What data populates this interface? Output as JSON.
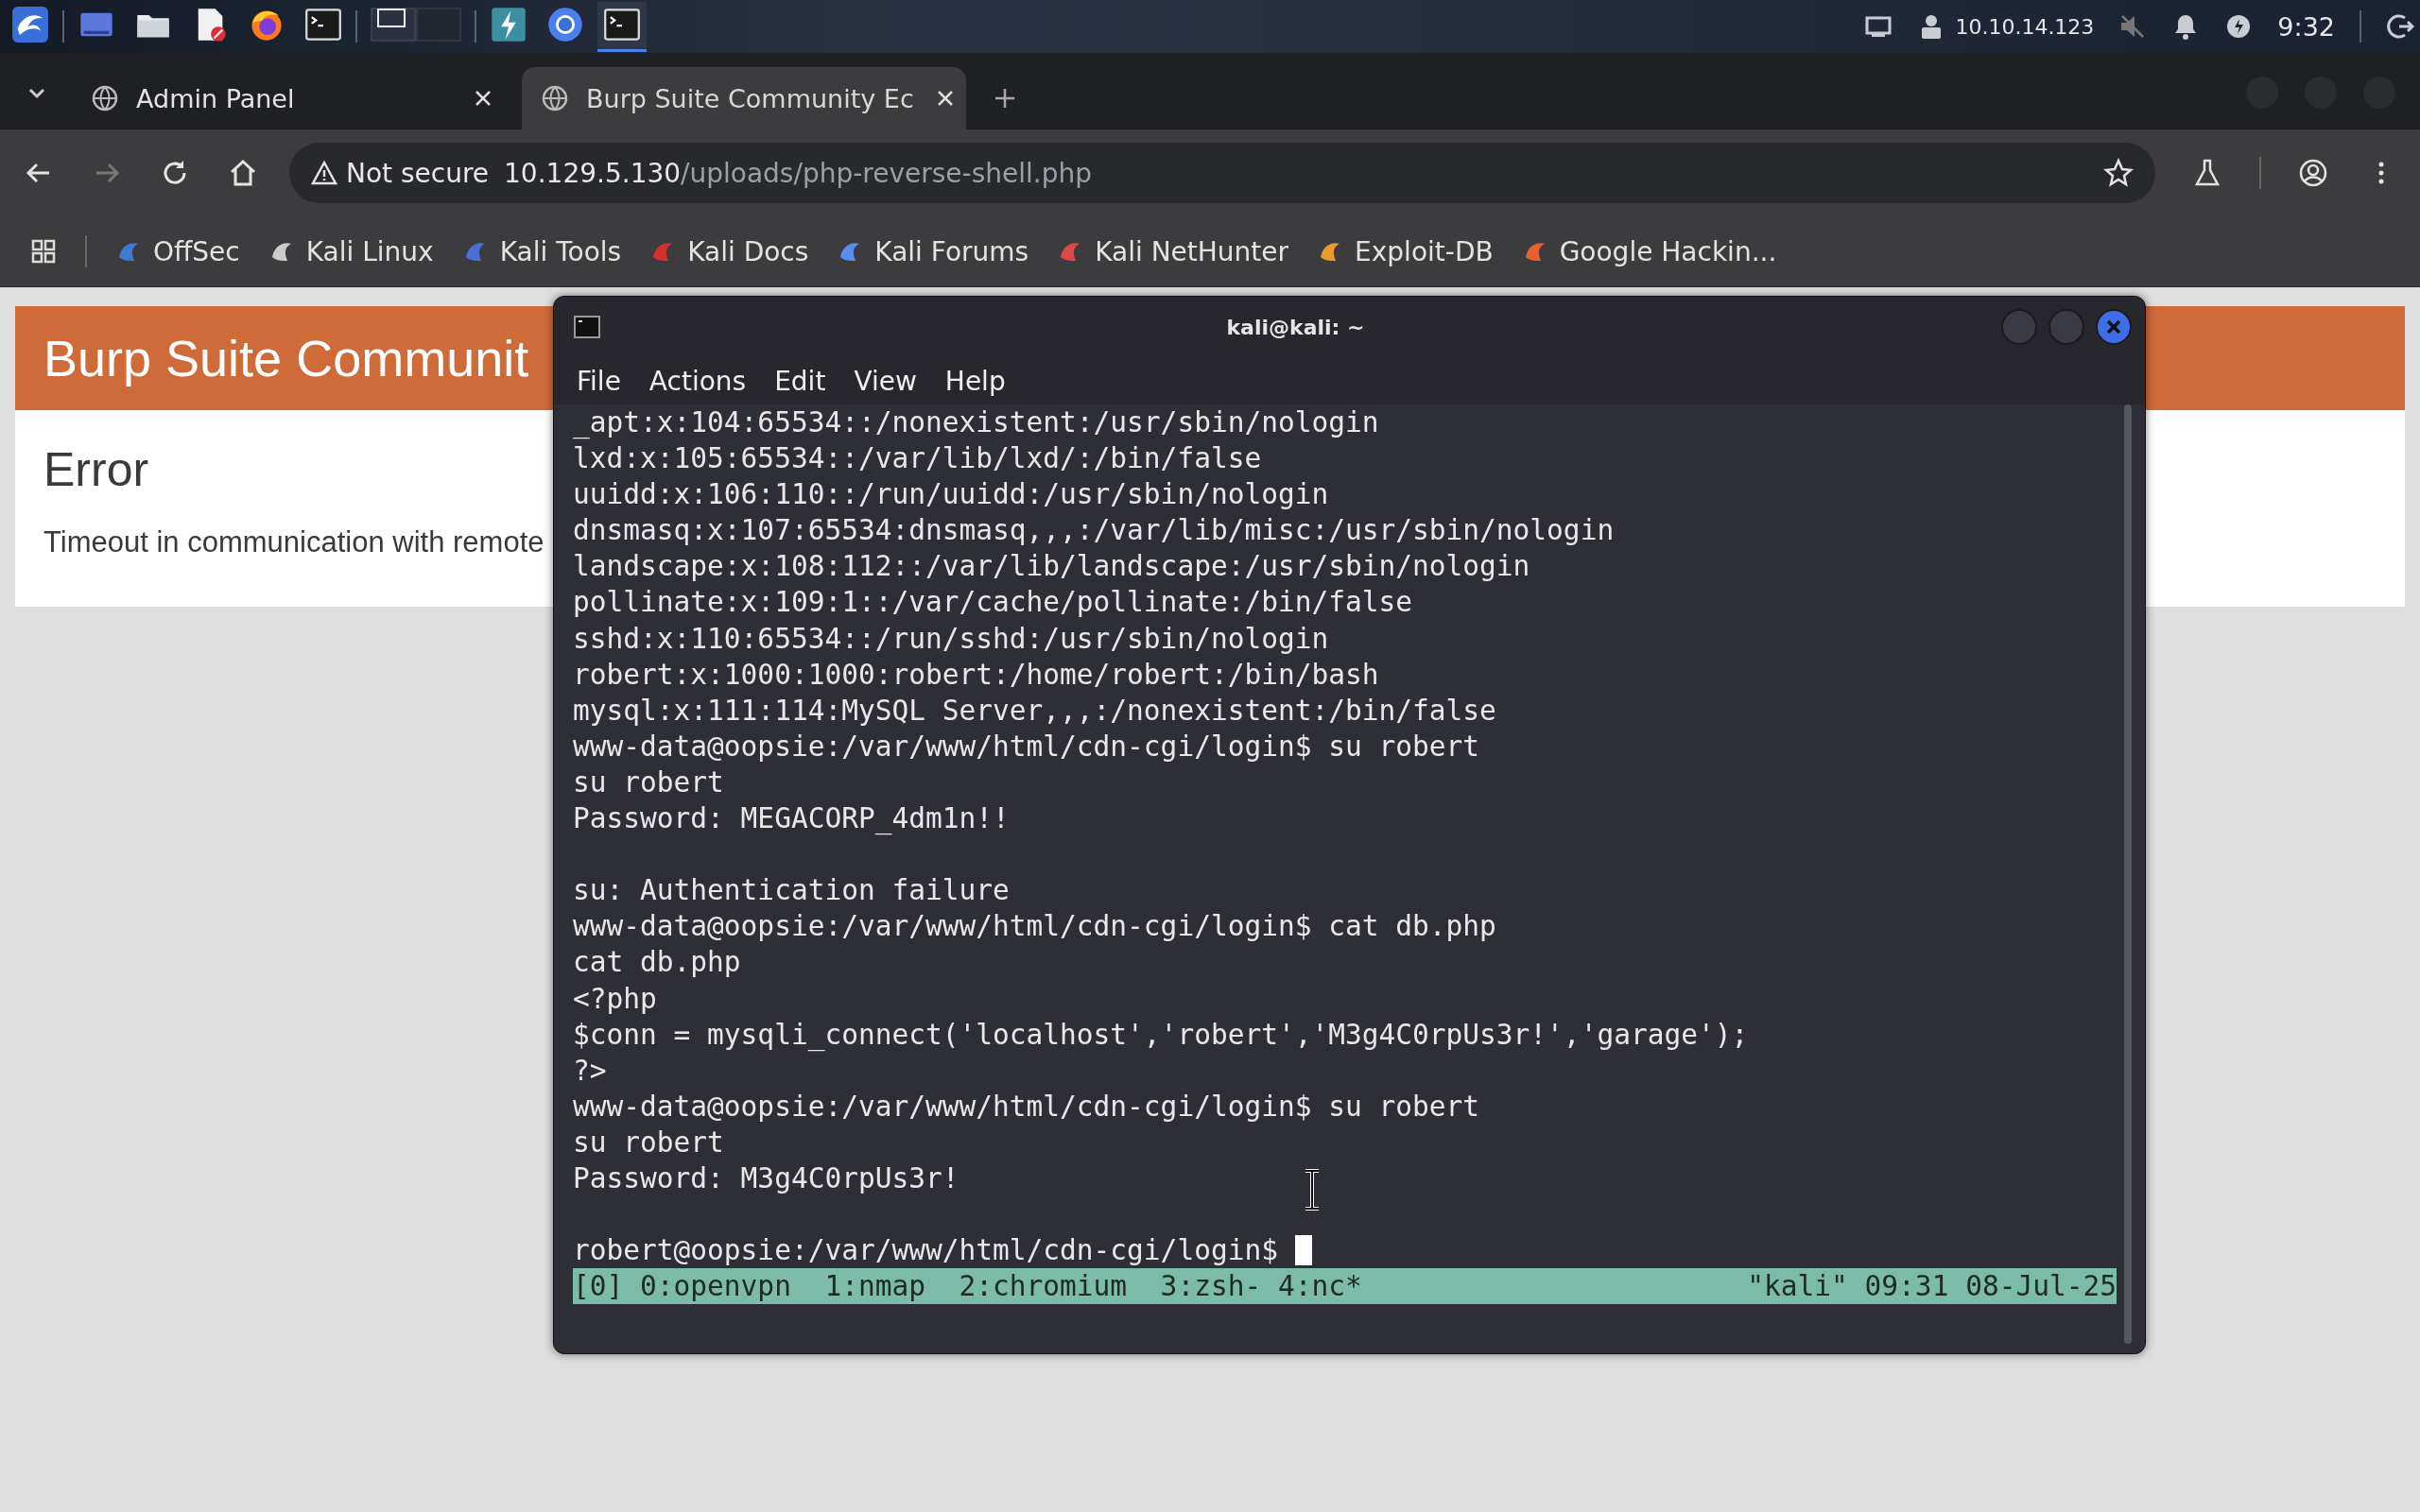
{
  "taskbar": {
    "apps": [
      {
        "kind": "menu",
        "selected": false
      },
      {
        "kind": "desktop",
        "selected": false
      },
      {
        "kind": "files",
        "selected": false
      },
      {
        "kind": "editor",
        "selected": false
      },
      {
        "kind": "firefox",
        "selected": false
      },
      {
        "kind": "terminal",
        "selected": false
      },
      {
        "kind": "workspaces",
        "selected": false
      },
      {
        "kind": "bolt",
        "selected": false
      },
      {
        "kind": "chromium",
        "selected": false
      },
      {
        "kind": "terminal",
        "selected": true
      }
    ],
    "ip": "10.10.14.123",
    "clock": "9:32"
  },
  "browser": {
    "tabs": [
      {
        "title": "Admin Panel",
        "selected": false
      },
      {
        "title": "Burp Suite Community Ec",
        "selected": true
      }
    ],
    "security": "Not secure",
    "url_host": "10.129.5.130",
    "url_path": "/uploads/php-reverse-shell.php",
    "bookmarks": [
      {
        "label": "OffSec",
        "color": "#3d7bd6"
      },
      {
        "label": "Kali Linux",
        "color": "#cccccc"
      },
      {
        "label": "Kali Tools",
        "color": "#4a6fd8"
      },
      {
        "label": "Kali Docs",
        "color": "#d32f2f"
      },
      {
        "label": "Kali Forums",
        "color": "#5b8def"
      },
      {
        "label": "Kali NetHunter",
        "color": "#e04848"
      },
      {
        "label": "Exploit-DB",
        "color": "#e89a2c"
      },
      {
        "label": "Google Hackin...",
        "color": "#e8602c"
      }
    ]
  },
  "page": {
    "title": "Burp Suite Communit",
    "heading": "Error",
    "message": "Timeout in communication with remote"
  },
  "terminal": {
    "title": "kali@kali: ~",
    "menu": [
      "File",
      "Actions",
      "Edit",
      "View",
      "Help"
    ],
    "lines": [
      {
        "text": "_apt:x:104:65534::/nonexistent:/usr/sbin/nologin",
        "blank_after": false,
        "cursor": false
      },
      {
        "text": "lxd:x:105:65534::/var/lib/lxd/:/bin/false",
        "blank_after": false,
        "cursor": false
      },
      {
        "text": "uuidd:x:106:110::/run/uuidd:/usr/sbin/nologin",
        "blank_after": false,
        "cursor": false
      },
      {
        "text": "dnsmasq:x:107:65534:dnsmasq,,,:/var/lib/misc:/usr/sbin/nologin",
        "blank_after": false,
        "cursor": false
      },
      {
        "text": "landscape:x:108:112::/var/lib/landscape:/usr/sbin/nologin",
        "blank_after": false,
        "cursor": false
      },
      {
        "text": "pollinate:x:109:1::/var/cache/pollinate:/bin/false",
        "blank_after": false,
        "cursor": false
      },
      {
        "text": "sshd:x:110:65534::/run/sshd:/usr/sbin/nologin",
        "blank_after": false,
        "cursor": false
      },
      {
        "text": "robert:x:1000:1000:robert:/home/robert:/bin/bash",
        "blank_after": false,
        "cursor": false
      },
      {
        "text": "mysql:x:111:114:MySQL Server,,,:/nonexistent:/bin/false",
        "blank_after": false,
        "cursor": false
      },
      {
        "text": "www-data@oopsie:/var/www/html/cdn-cgi/login$ su robert",
        "blank_after": false,
        "cursor": false
      },
      {
        "text": "su robert",
        "blank_after": false,
        "cursor": false
      },
      {
        "text": "Password: MEGACORP_4dm1n!!",
        "blank_after": true,
        "cursor": false
      },
      {
        "text": "su: Authentication failure",
        "blank_after": false,
        "cursor": false
      },
      {
        "text": "www-data@oopsie:/var/www/html/cdn-cgi/login$ cat db.php",
        "blank_after": false,
        "cursor": false
      },
      {
        "text": "cat db.php",
        "blank_after": false,
        "cursor": false
      },
      {
        "text": "<?php",
        "blank_after": false,
        "cursor": false
      },
      {
        "text": "$conn = mysqli_connect('localhost','robert','M3g4C0rpUs3r!','garage');",
        "blank_after": false,
        "cursor": false
      },
      {
        "text": "?>",
        "blank_after": false,
        "cursor": false
      },
      {
        "text": "www-data@oopsie:/var/www/html/cdn-cgi/login$ su robert",
        "blank_after": false,
        "cursor": false
      },
      {
        "text": "su robert",
        "blank_after": false,
        "cursor": false
      },
      {
        "text": "Password: M3g4C0rpUs3r!",
        "blank_after": true,
        "cursor": false
      },
      {
        "text": "robert@oopsie:/var/www/html/cdn-cgi/login$",
        "blank_after": false,
        "cursor": true
      }
    ],
    "status_left": "[0] 0:openvpn  1:nmap  2:chromium  3:zsh- 4:nc*",
    "status_right": "\"kali\" 09:31 08-Jul-25"
  }
}
